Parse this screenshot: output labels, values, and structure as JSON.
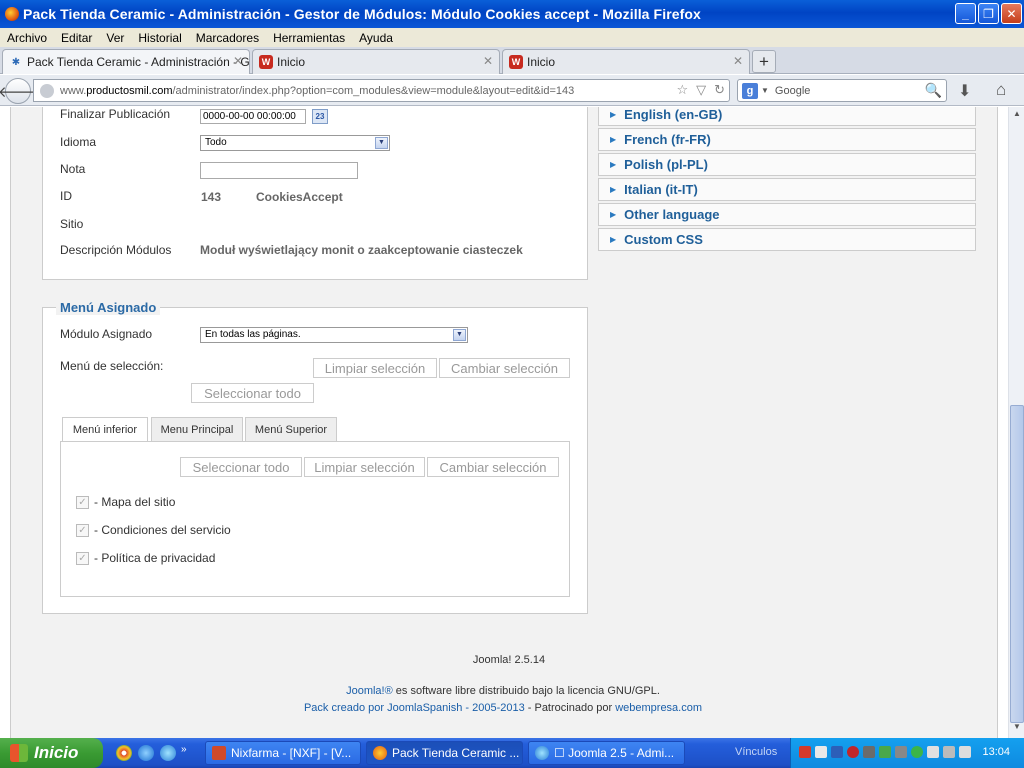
{
  "window": {
    "title": "Pack Tienda Ceramic - Administración - Gestor de Módulos: Módulo Cookies accept - Mozilla Firefox"
  },
  "menubar": [
    "Archivo",
    "Editar",
    "Ver",
    "Historial",
    "Marcadores",
    "Herramientas",
    "Ayuda"
  ],
  "tabs": [
    {
      "label": "Pack Tienda Ceramic - Administración - G...",
      "icon": "joomla-icon",
      "active": true
    },
    {
      "label": "Inicio",
      "icon": "webempresa-icon",
      "active": false
    },
    {
      "label": "Inicio",
      "icon": "webempresa-icon",
      "active": false
    }
  ],
  "url": {
    "prefix": "www.",
    "host": "productosmil.com",
    "path": "/administrator/index.php?option=com_modules&view=module&layout=edit&id=143"
  },
  "search": {
    "placeholder": "Google"
  },
  "details": {
    "finalizar_label": "Finalizar Publicación",
    "finalizar_value": "0000-00-00 00:00:00",
    "calendar_day": "23",
    "idioma_label": "Idioma",
    "idioma_value": "Todo",
    "nota_label": "Nota",
    "nota_value": "",
    "id_label": "ID",
    "id_value": "143",
    "id_name": "CookiesAccept",
    "sitio_label": "Sitio",
    "desc_label": "Descripción Módulos",
    "desc_value": "Moduł wyświetlający monit o zaakceptowanie ciasteczek"
  },
  "accordion": [
    "English (en-GB)",
    "French (fr-FR)",
    "Polish (pl-PL)",
    "Italian (it-IT)",
    "Other language",
    "Custom CSS"
  ],
  "menu_assign": {
    "legend": "Menú Asignado",
    "modulo_label": "Módulo Asignado",
    "modulo_value": "En todas las páginas.",
    "seleccion_label": "Menú de selección:",
    "btn_limpiar": "Limpiar selección",
    "btn_cambiar": "Cambiar selección",
    "btn_seleccionar": "Seleccionar todo",
    "tabs": [
      "Menú inferior",
      "Menu Principal",
      "Menú Superior"
    ],
    "items": [
      "- Mapa del sitio",
      "- Condiciones del servicio",
      "- Política de privacidad"
    ]
  },
  "footer": {
    "version": "Joomla! 2.5.14",
    "joomla_link": "Joomla!®",
    "license": " es software libre distribuido bajo la licencia GNU/GPL.",
    "credit_link": "Pack creado por JoomlaSpanish - 2005-2013",
    "credit_mid": " - Patrocinado por ",
    "sponsor_link": "webempresa.com"
  },
  "taskbar": {
    "start": "Inicio",
    "tasks": [
      {
        "label": "Nixfarma - [NXF] - [V...",
        "icon": "nixfarma-icon"
      },
      {
        "label": "Pack Tienda Ceramic ...",
        "icon": "firefox-icon",
        "active": true
      },
      {
        "label": "☐ Joomla 2.5 - Admi...",
        "icon": "ie-icon"
      }
    ],
    "vinculos": "Vínculos",
    "clock": "13:04"
  }
}
